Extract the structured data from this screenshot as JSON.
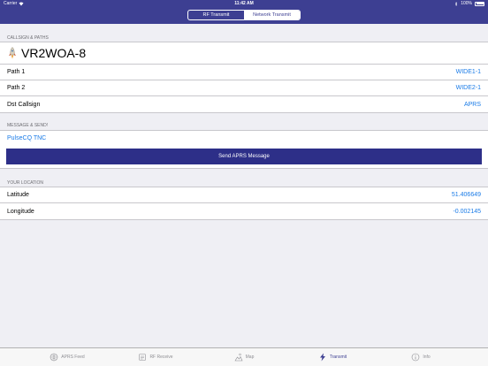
{
  "status_bar": {
    "carrier": "Carrier",
    "time": "11:42 AM",
    "battery": "100%"
  },
  "segmented_control": {
    "options": [
      "RF Transmit",
      "Network Transmit"
    ],
    "selected_index": 1
  },
  "callsign_section": {
    "header": "CALLSIGN & PATHS",
    "callsign": "VR2WOA-8",
    "rows": [
      {
        "label": "Path 1",
        "value": "WIDE1-1"
      },
      {
        "label": "Path 2",
        "value": "WIDE2-1"
      },
      {
        "label": "Dst Callsign",
        "value": "APRS"
      }
    ]
  },
  "message_section": {
    "header": "MESSAGE & SEND!",
    "message": "PulseCQ TNC",
    "send_label": "Send APRS Message"
  },
  "location_section": {
    "header": "YOUR LOCATION",
    "rows": [
      {
        "label": "Latitude",
        "value": "51.406649"
      },
      {
        "label": "Longitude",
        "value": "-0.002145"
      }
    ]
  },
  "tab_bar": {
    "tabs": [
      {
        "label": "APRS Feed",
        "icon": "aprs-feed-icon"
      },
      {
        "label": "RF Receive",
        "icon": "rf-receive-icon"
      },
      {
        "label": "Map",
        "icon": "map-icon"
      },
      {
        "label": "Transmit",
        "icon": "lightning-icon"
      },
      {
        "label": "Info",
        "icon": "info-icon"
      }
    ],
    "active_index": 3
  },
  "colors": {
    "nav": "#3d3f92",
    "accent": "#1a7be7",
    "button": "#2d2f88"
  }
}
